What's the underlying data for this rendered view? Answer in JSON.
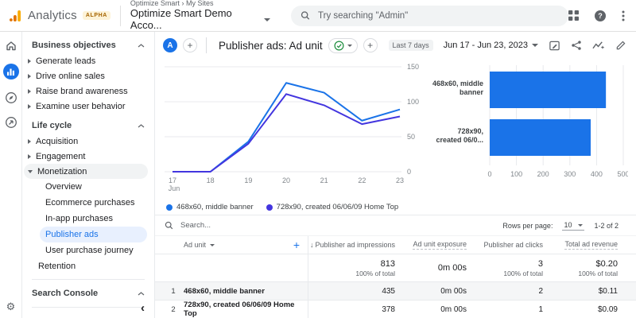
{
  "colors": {
    "accent": "#1a73e8",
    "series1": "#1a73e8",
    "series2": "#4335df",
    "selected_bg": "#e8f0fe",
    "green": "#1e8e3e",
    "logo_orange": "#f9ab00"
  },
  "topbar": {
    "brand": "Analytics",
    "alpha_badge": "ALPHA",
    "breadcrumb": {
      "path": "Optimize Smart",
      "sep": "›",
      "current": "My Sites"
    },
    "account_selector": "Optimize Smart Demo Acco...",
    "search_placeholder": "Try searching \"Admin\""
  },
  "sidebar": {
    "business_objectives": {
      "header": "Business objectives",
      "items": [
        {
          "label": "Generate leads"
        },
        {
          "label": "Drive online sales"
        },
        {
          "label": "Raise brand awareness"
        },
        {
          "label": "Examine user behavior"
        }
      ]
    },
    "life_cycle": {
      "header": "Life cycle",
      "acquisition": "Acquisition",
      "engagement": "Engagement",
      "monetization": "Monetization",
      "monetization_children": [
        {
          "label": "Overview"
        },
        {
          "label": "Ecommerce purchases"
        },
        {
          "label": "In-app purchases"
        },
        {
          "label": "Publisher ads"
        },
        {
          "label": "User purchase journey"
        }
      ],
      "selected_child": "Publisher ads",
      "retention": "Retention"
    },
    "search_console": "Search Console",
    "collapse": "‹"
  },
  "report_header": {
    "comparison_chip": "A",
    "title": "Publisher ads: Ad unit",
    "date_preset": "Last 7 days",
    "date_range": "Jun 17 - Jun 23, 2023"
  },
  "chart_data": [
    {
      "type": "line",
      "x": [
        "17",
        "18",
        "19",
        "20",
        "21",
        "22",
        "23"
      ],
      "x_first_sublabel": "Jun",
      "series": [
        {
          "name": "468x60, middle banner",
          "color": "#1a73e8",
          "values": [
            0,
            0,
            43,
            127,
            113,
            73,
            89
          ]
        },
        {
          "name": "728x90, created 06/06/09 Home Top",
          "color": "#4335df",
          "values": [
            0,
            0,
            40,
            111,
            95,
            68,
            79
          ]
        }
      ],
      "ylim": [
        0,
        150
      ],
      "yticks": [
        0,
        50,
        100,
        150
      ],
      "y_axis_side": "right",
      "grid": true,
      "legend_position": "bottom"
    },
    {
      "type": "bar",
      "orientation": "horizontal",
      "categories": [
        "468x60, middle banner",
        "728x90, created 06/06/09 Home Top"
      ],
      "category_lines": [
        [
          "468x60, middle",
          "banner"
        ],
        [
          "728x90,",
          "created 06/0..."
        ]
      ],
      "values": [
        435,
        378
      ],
      "color": "#1a73e8",
      "xlim": [
        0,
        500
      ],
      "xticks": [
        0,
        100,
        200,
        300,
        400,
        500
      ],
      "grid": true
    }
  ],
  "table": {
    "search_placeholder": "Search...",
    "rows_per_page_label": "Rows per page:",
    "rows_per_page_value": "10",
    "pagination": "1-2 of 2",
    "columns": {
      "dimension": "Ad unit",
      "impressions": "Publisher ad impressions",
      "exposure": "Ad unit exposure",
      "clicks": "Publisher ad clicks",
      "revenue": "Total ad revenue"
    },
    "sort_arrow": "↓",
    "totals": {
      "impressions": "813",
      "impressions_sub": "100% of total",
      "exposure": "0m 00s",
      "clicks": "3",
      "clicks_sub": "100% of total",
      "revenue": "$0.20",
      "revenue_sub": "100% of total"
    },
    "rows": [
      {
        "index": "1",
        "ad_unit": "468x60, middle banner",
        "impressions": "435",
        "exposure": "0m 00s",
        "clicks": "2",
        "revenue": "$0.11"
      },
      {
        "index": "2",
        "ad_unit": "728x90, created 06/06/09 Home Top",
        "impressions": "378",
        "exposure": "0m 00s",
        "clicks": "1",
        "revenue": "$0.09"
      }
    ]
  }
}
